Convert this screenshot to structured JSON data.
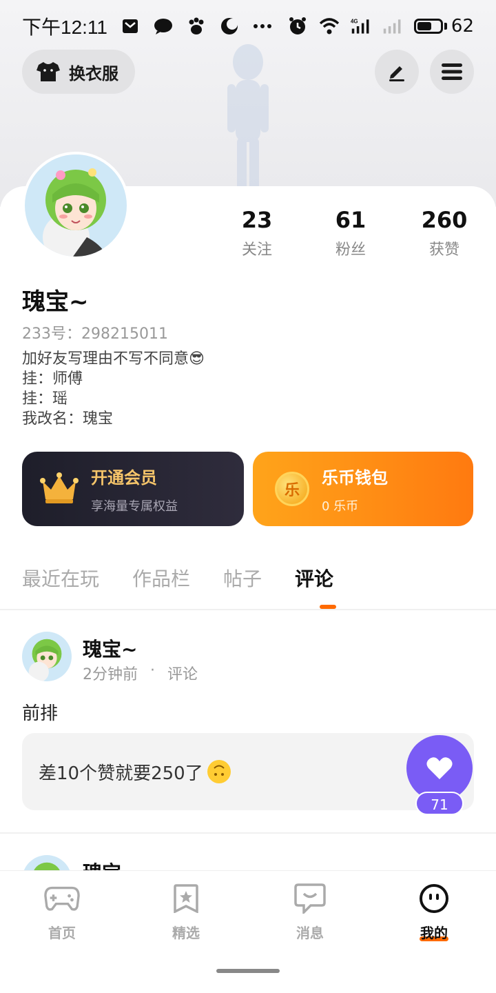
{
  "status_bar": {
    "time": "下午12:11",
    "battery": "62",
    "battery_percent": 62,
    "icons": [
      "mail-icon",
      "chat-icon",
      "baidu-icon",
      "moon-icon",
      "more-dots-icon",
      "alarm-icon",
      "wifi-icon",
      "signal-4g-icon",
      "signal-icon"
    ]
  },
  "header": {
    "change_outfit_label": "换衣服",
    "edit_icon": "pencil-icon",
    "menu_icon": "menu-icon"
  },
  "profile": {
    "stats": [
      {
        "value": "23",
        "label": "关注"
      },
      {
        "value": "61",
        "label": "粉丝"
      },
      {
        "value": "260",
        "label": "获赞"
      }
    ],
    "username": "瑰宝~",
    "uid": "233号：298215011",
    "bio": "加好友写理由不写不同意😎\n挂：师傅\n挂：瑶\n我改名：瑰宝"
  },
  "cards": {
    "member_title": "开通会员",
    "member_sub": "享海量专属权益",
    "wallet_title": "乐币钱包",
    "wallet_sub": "0  乐币",
    "wallet_coin_text": "乐"
  },
  "tabs": [
    {
      "label": "最近在玩",
      "active": false
    },
    {
      "label": "作品栏",
      "active": false
    },
    {
      "label": "帖子",
      "active": false
    },
    {
      "label": "评论",
      "active": true
    }
  ],
  "post": {
    "author": "瑰宝~",
    "time": "2分钟前",
    "dot": "·",
    "type": "评论",
    "text": "前排",
    "quote": "差10个赞就要250了",
    "like_count": "71"
  },
  "post2": {
    "author": "瑰宝~"
  },
  "bottom_nav": [
    {
      "label": "首页",
      "icon": "gamepad-icon",
      "active": false
    },
    {
      "label": "精选",
      "icon": "star-bookmark-icon",
      "active": false
    },
    {
      "label": "消息",
      "icon": "message-bubble-icon",
      "active": false
    },
    {
      "label": "我的",
      "icon": "face-icon",
      "active": true
    }
  ],
  "colors": {
    "accent": "#ff6a00",
    "like": "#7a5cf5",
    "member_gold": "#f6c56a",
    "wallet_orange": "#ff8c14"
  }
}
